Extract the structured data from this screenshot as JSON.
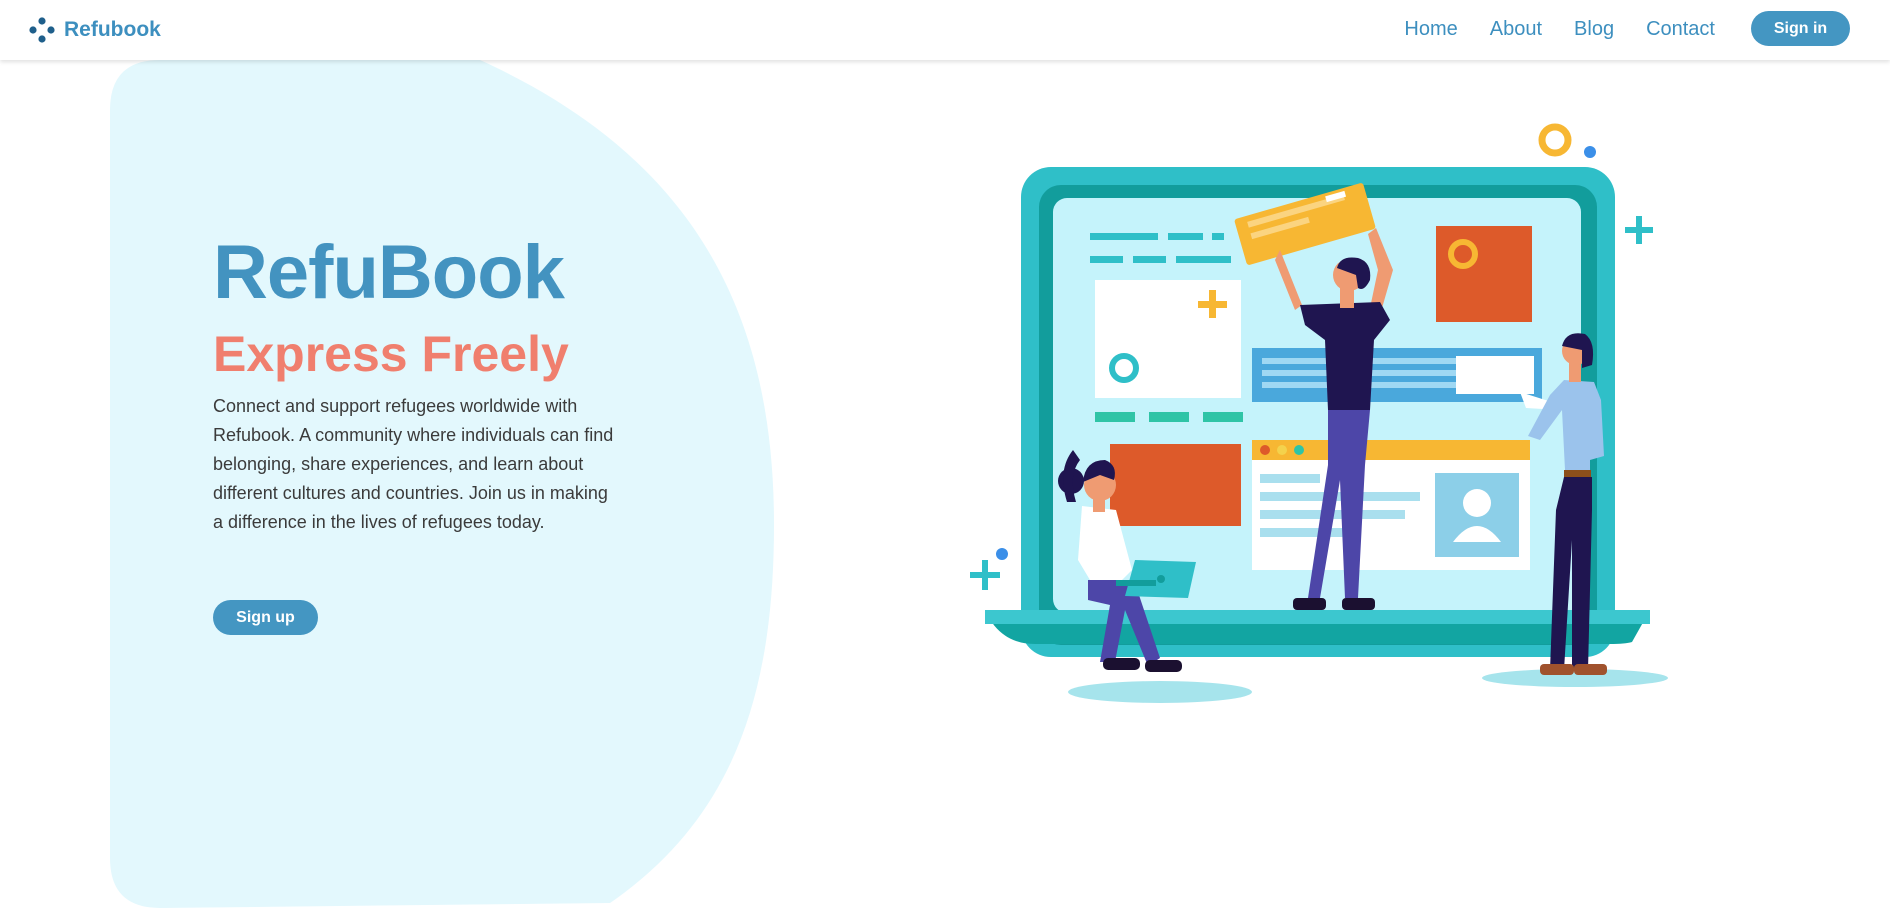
{
  "navbar": {
    "brand": {
      "name": "Refubook",
      "icon": "dots-logo-icon"
    },
    "links": [
      {
        "label": "Home"
      },
      {
        "label": "About"
      },
      {
        "label": "Blog"
      },
      {
        "label": "Contact"
      }
    ],
    "signin_label": "Sign in"
  },
  "hero": {
    "title": "RefuBook",
    "subtitle": "Express Freely",
    "description": "Connect and support refugees worldwide with Refubook. A community where individuals can find belonging, share experiences, and learn about different cultures and countries. Join us in making a difference in the lives of refugees today.",
    "signup_label": "Sign up"
  },
  "colors": {
    "brand_blue": "#4393c0",
    "accent_coral": "#f07f6e",
    "hero_background": "#e3f8fd",
    "button_blue": "#4496c2"
  }
}
